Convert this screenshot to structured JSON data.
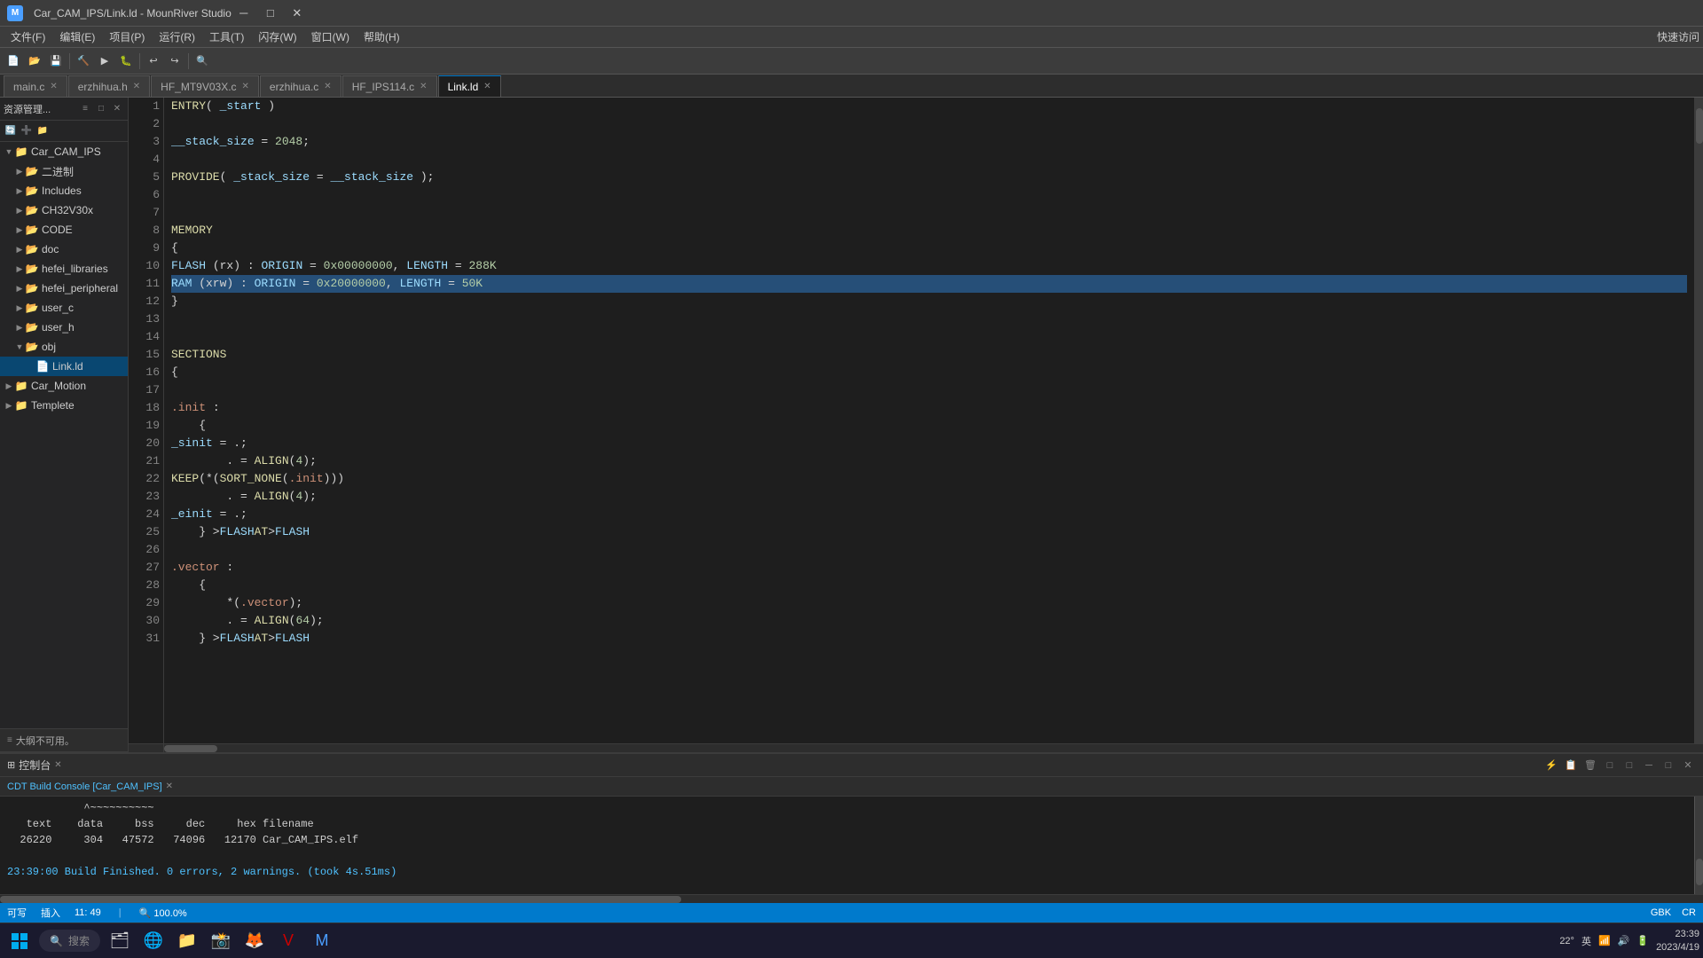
{
  "titlebar": {
    "title": "Car_CAM_IPS/Link.ld - MounRiver Studio",
    "icon": "app-icon",
    "min_label": "─",
    "max_label": "□",
    "close_label": "✕"
  },
  "menubar": {
    "items": [
      "文件(F)",
      "编辑(E)",
      "项目(P)",
      "运行(R)",
      "工具(T)",
      "闪存(W)",
      "窗口(W)",
      "帮助(H)"
    ],
    "quick_access_label": "快速访问"
  },
  "tabs": [
    {
      "label": "main.c",
      "icon": "c-file",
      "active": false,
      "closable": true
    },
    {
      "label": "erzhihua.h",
      "icon": "h-file",
      "active": false,
      "closable": true
    },
    {
      "label": "HF_MT9V03X.c",
      "icon": "c-file",
      "active": false,
      "closable": true
    },
    {
      "label": "erzhihua.c",
      "icon": "c-file",
      "active": false,
      "closable": true
    },
    {
      "label": "HF_IPS114.c",
      "icon": "c-file",
      "active": false,
      "closable": true
    },
    {
      "label": "Link.ld",
      "icon": "ld-file",
      "active": true,
      "closable": true
    }
  ],
  "sidebar": {
    "header": "资源管理...",
    "tree": [
      {
        "level": 0,
        "label": "Car_CAM_IPS",
        "arrow": "▼",
        "icon": "📁",
        "type": "folder-open"
      },
      {
        "level": 1,
        "label": "二进制",
        "arrow": "▶",
        "icon": "📂",
        "type": "folder"
      },
      {
        "level": 1,
        "label": "Includes",
        "arrow": "▶",
        "icon": "📂",
        "type": "folder"
      },
      {
        "level": 1,
        "label": "CH32V30x",
        "arrow": "▶",
        "icon": "📂",
        "type": "folder"
      },
      {
        "level": 1,
        "label": "CODE",
        "arrow": "▶",
        "icon": "📂",
        "type": "folder"
      },
      {
        "level": 1,
        "label": "doc",
        "arrow": "▶",
        "icon": "📂",
        "type": "folder"
      },
      {
        "level": 1,
        "label": "hefei_libraries",
        "arrow": "▶",
        "icon": "📂",
        "type": "folder"
      },
      {
        "level": 1,
        "label": "hefei_peripheral",
        "arrow": "▶",
        "icon": "📂",
        "type": "folder"
      },
      {
        "level": 1,
        "label": "user_c",
        "arrow": "▶",
        "icon": "📂",
        "type": "folder"
      },
      {
        "level": 1,
        "label": "user_h",
        "arrow": "▶",
        "icon": "📂",
        "type": "folder"
      },
      {
        "level": 1,
        "label": "obj",
        "arrow": "▶",
        "icon": "📂",
        "type": "folder"
      },
      {
        "level": 2,
        "label": "Link.ld",
        "arrow": "",
        "icon": "📄",
        "type": "file",
        "selected": true
      },
      {
        "level": 0,
        "label": "Car_Motion",
        "arrow": "▶",
        "icon": "📁",
        "type": "folder"
      },
      {
        "level": 0,
        "label": "Templete",
        "arrow": "▶",
        "icon": "📁",
        "type": "folder"
      }
    ]
  },
  "editor": {
    "filename": "Link.ld",
    "lines": [
      {
        "n": 1,
        "code": "ENTRY( _start )"
      },
      {
        "n": 2,
        "code": ""
      },
      {
        "n": 3,
        "code": "__stack_size = 2048;"
      },
      {
        "n": 4,
        "code": ""
      },
      {
        "n": 5,
        "code": "PROVIDE( _stack_size = __stack_size );"
      },
      {
        "n": 6,
        "code": ""
      },
      {
        "n": 7,
        "code": ""
      },
      {
        "n": 8,
        "code": "MEMORY"
      },
      {
        "n": 9,
        "code": "{"
      },
      {
        "n": 10,
        "code": "    FLASH (rx) : ORIGIN = 0x00000000, LENGTH = 288K"
      },
      {
        "n": 11,
        "code": "    RAM (xrw) : ORIGIN = 0x20000000, LENGTH = 50K",
        "highlighted": true
      },
      {
        "n": 12,
        "code": "}"
      },
      {
        "n": 13,
        "code": ""
      },
      {
        "n": 14,
        "code": ""
      },
      {
        "n": 15,
        "code": "SECTIONS"
      },
      {
        "n": 16,
        "code": "{"
      },
      {
        "n": 17,
        "code": ""
      },
      {
        "n": 18,
        "code": "    .init :"
      },
      {
        "n": 19,
        "code": "    {"
      },
      {
        "n": 20,
        "code": "        _sinit = .;"
      },
      {
        "n": 21,
        "code": "        . = ALIGN(4);"
      },
      {
        "n": 22,
        "code": "        KEEP(*(SORT_NONE(.init)))"
      },
      {
        "n": 23,
        "code": "        . = ALIGN(4);"
      },
      {
        "n": 24,
        "code": "        _einit = .;"
      },
      {
        "n": 25,
        "code": "    } >FLASH AT>FLASH"
      },
      {
        "n": 26,
        "code": ""
      },
      {
        "n": 27,
        "code": "    .vector :"
      },
      {
        "n": 28,
        "code": "    {"
      },
      {
        "n": 29,
        "code": "        *(.vector);"
      },
      {
        "n": 30,
        "code": "        . = ALIGN(64);"
      },
      {
        "n": 31,
        "code": "    } >FLASH AT>FLASH"
      }
    ]
  },
  "outline": {
    "label": "大纲不可用。"
  },
  "console": {
    "title": "控制台",
    "tab_label": "CDT Build Console [Car_CAM_IPS]",
    "lines": [
      {
        "text": "            ^~~~~~~~~~~",
        "type": "normal"
      },
      {
        "text": "   text    data     bss     dec     hex filename",
        "type": "normal"
      },
      {
        "text": "  26220     304   47572   74096   12170 Car_CAM_IPS.elf",
        "type": "normal"
      },
      {
        "text": "",
        "type": "normal"
      },
      {
        "text": "23:39:00 Build Finished. 0 errors, 2 warnings. (took 4s.51ms)",
        "type": "success"
      }
    ]
  },
  "statusbar": {
    "writable": "可写",
    "insert": "插入",
    "position": "11: 49",
    "zoom": "100.0%",
    "encoding": "GBK",
    "line_ending": "CR"
  },
  "taskbar": {
    "search_placeholder": "搜索",
    "time": "23:39",
    "date": "2023/4/19",
    "temp": "22°"
  }
}
